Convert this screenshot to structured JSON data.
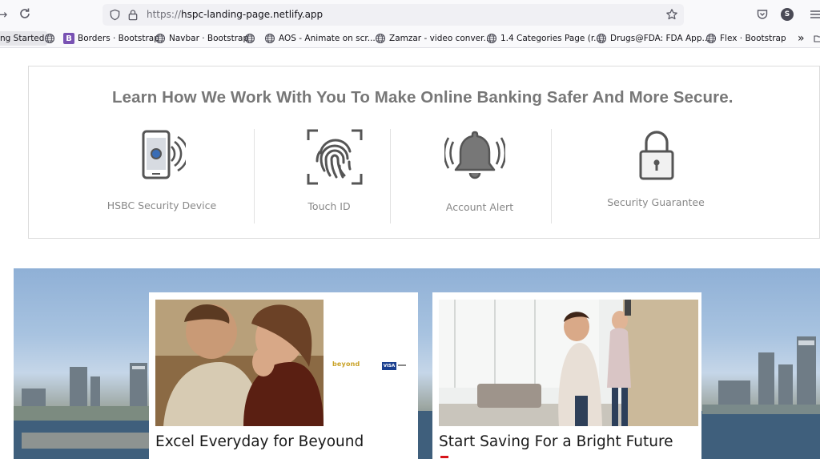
{
  "browser": {
    "url_protocol": "https://",
    "url_host": "hspc-landing-page.netlify.app",
    "profile_initial": "S",
    "bookmarks": [
      {
        "label": "ng Started",
        "icon": "none"
      },
      {
        "label": "",
        "icon": "globe-icon"
      },
      {
        "label": "Borders · Bootstrap",
        "icon": "bootstrap-icon"
      },
      {
        "label": "Navbar · Bootstrap",
        "icon": "globe-icon"
      },
      {
        "label": "",
        "icon": "globe-icon"
      },
      {
        "label": "AOS - Animate on scr...",
        "icon": "globe-icon"
      },
      {
        "label": "Zamzar - video conver...",
        "icon": "globe-icon"
      },
      {
        "label": "1.4 Categories Page (r...",
        "icon": "globe-icon"
      },
      {
        "label": "Drugs@FDA: FDA App...",
        "icon": "globe-icon"
      },
      {
        "label": "Flex · Bootstrap",
        "icon": "globe-icon"
      }
    ],
    "overflow_glyph": "»"
  },
  "security": {
    "heading": "Learn How We Work With You To Make Online Banking Safer And More Secure.",
    "features": [
      {
        "label": "HSBC Security Device",
        "icon": "phone-device-icon"
      },
      {
        "label": "Touch ID",
        "icon": "fingerprint-icon"
      },
      {
        "label": "Account Alert",
        "icon": "bell-icon"
      },
      {
        "label": "Security Guarantee",
        "icon": "padlock-icon"
      }
    ]
  },
  "cards": [
    {
      "title": "Excel Everyday for Beyound",
      "logo_text": "beyond",
      "brand_text": "VISA"
    },
    {
      "title": "Start Saving For a Bright Future"
    }
  ],
  "colors": {
    "heading_gray": "#777777",
    "label_gray": "#888888",
    "icon_gray": "#555555",
    "icon_blue": "#3a6db5",
    "beyond_gold": "#c9a227"
  }
}
